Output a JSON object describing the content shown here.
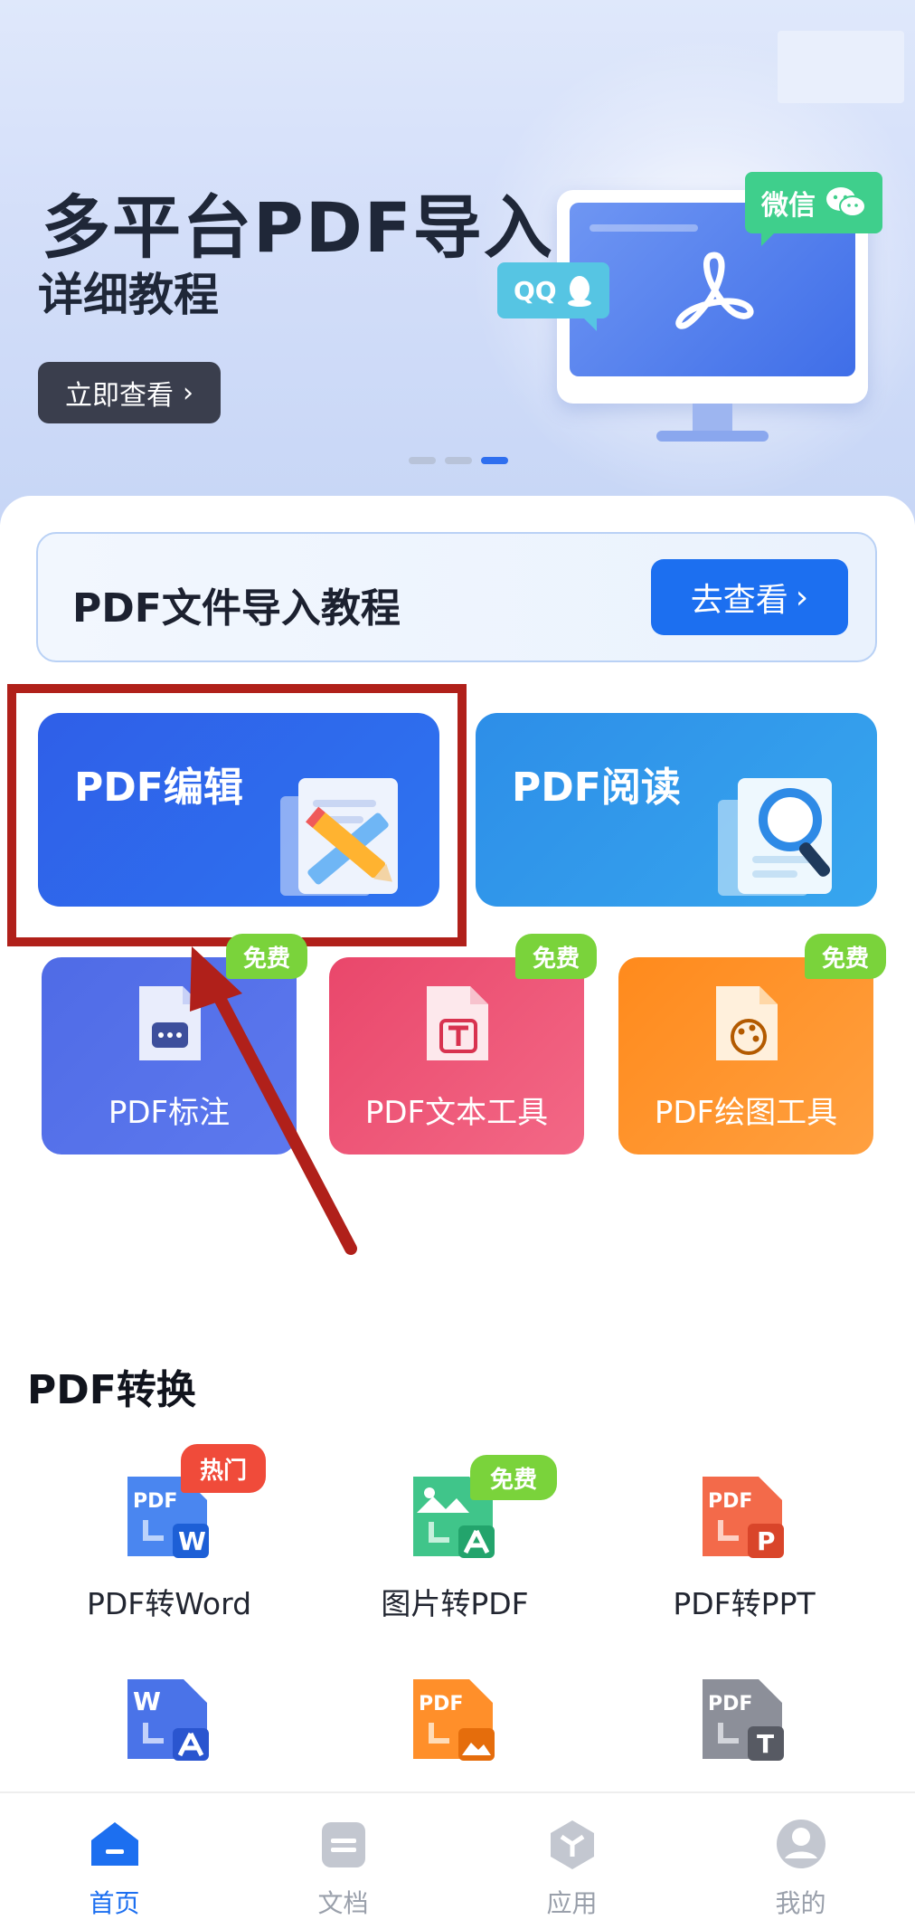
{
  "banner": {
    "title": "多平台PDF导入",
    "subtitle": "详细教程",
    "view_button": "立即查看",
    "bubble_qq": "QQ",
    "bubble_wechat": "微信",
    "carousel_pages": 3,
    "carousel_active": 3
  },
  "tutorial": {
    "label": "PDF文件导入教程",
    "button": "去查看"
  },
  "tools": {
    "edit": "PDF编辑",
    "read": "PDF阅读",
    "small": [
      {
        "label": "PDF标注",
        "badge": "免费"
      },
      {
        "label": "PDF文本工具",
        "badge": "免费"
      },
      {
        "label": "PDF绘图工具",
        "badge": "免费"
      }
    ]
  },
  "conversion": {
    "title": "PDF转换",
    "items": [
      {
        "label": "PDF转Word",
        "badge": "热门"
      },
      {
        "label": "图片转PDF",
        "badge": "免费"
      },
      {
        "label": "PDF转PPT"
      }
    ]
  },
  "nav": [
    {
      "label": "首页",
      "active": true
    },
    {
      "label": "文档"
    },
    {
      "label": "应用"
    },
    {
      "label": "我的"
    }
  ],
  "colors": {
    "accent": "#1c6ff0",
    "highlight": "#b0201a",
    "free": "#7ad33b",
    "hot": "#f04b3a"
  }
}
